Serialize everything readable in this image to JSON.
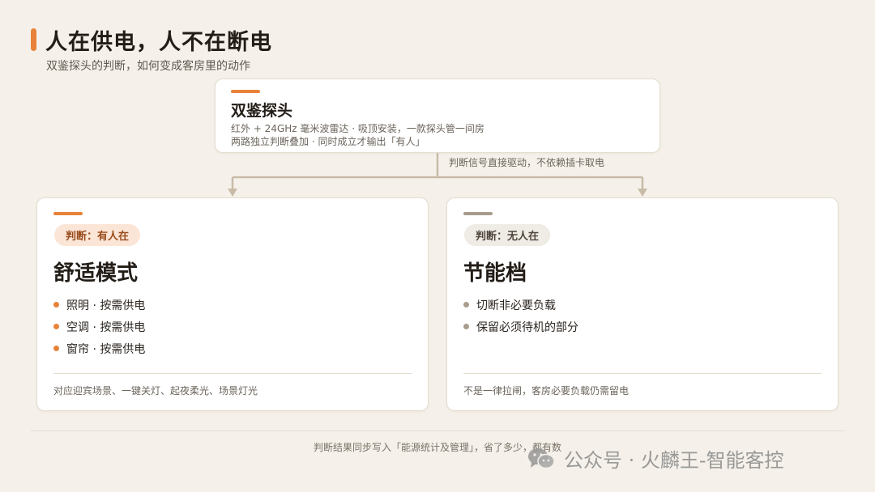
{
  "header": {
    "title": "人在供电，人不在断电",
    "subtitle": "双鉴探头的判断，如何变成客房里的动作"
  },
  "sensor": {
    "title": "双鉴探头",
    "line1": "红外 + 24GHz 毫米波雷达 · 吸顶安装，一款探头管一间房",
    "line2": "两路独立判断叠加 · 同时成立才输出「有人」"
  },
  "signal_note": "判断信号直接驱动，不依赖插卡取电",
  "modes": [
    {
      "badge": "判断：有人在",
      "title": "舒适模式",
      "items": [
        "照明 · 按需供电",
        "空调 · 按需供电",
        "窗帘 · 按需供电"
      ],
      "note": "对应迎宾场景、一键关灯、起夜柔光、场景灯光"
    },
    {
      "badge": "判断：无人在",
      "title": "节能档",
      "items": [
        "切断非必要负载",
        "保留必须待机的部分"
      ],
      "note": "不是一律拉闸，客房必要负载仍需留电"
    }
  ],
  "footer": {
    "note": "判断结果同步写入「能源统计及管理」，省了多少，都有数"
  },
  "watermark": {
    "text": "公众号 · 火麟王-智能客控",
    "icon": "wechat-icon"
  },
  "colors": {
    "background": "#f5f1ea",
    "accent_orange": "#e8823a",
    "accent_gray": "#a99c8d",
    "connector": "#c8bba8"
  }
}
